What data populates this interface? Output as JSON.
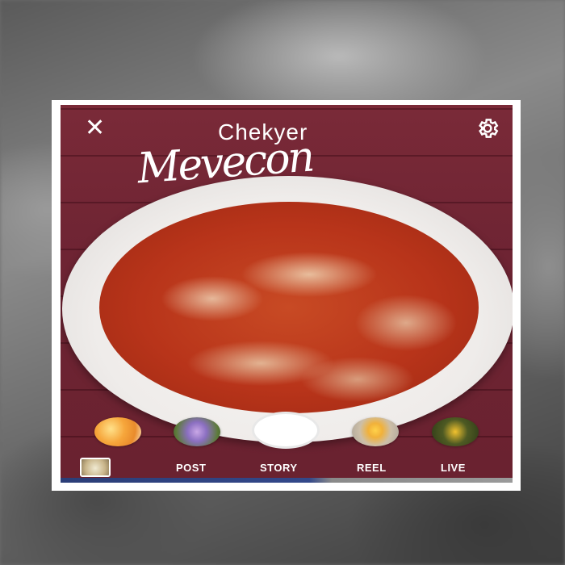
{
  "app": {
    "title": "Chekyer",
    "script_title": "Mevecon"
  },
  "topbar": {
    "close_icon": "close-icon",
    "settings_icon": "gear-icon"
  },
  "filters": [
    {
      "name": "orange-slices-filter",
      "icon": "filter-thumbnail"
    },
    {
      "name": "purple-flowers-filter",
      "icon": "filter-thumbnail"
    },
    {
      "name": "citrus-filter",
      "icon": "filter-thumbnail"
    },
    {
      "name": "yellow-flowers-filter",
      "icon": "filter-thumbnail"
    }
  ],
  "modes": {
    "post": "POST",
    "story": "STORY",
    "reel": "REEL",
    "live": "LIVE"
  },
  "colors": {
    "surface": "#6e2433",
    "accent": "#ffffff"
  }
}
